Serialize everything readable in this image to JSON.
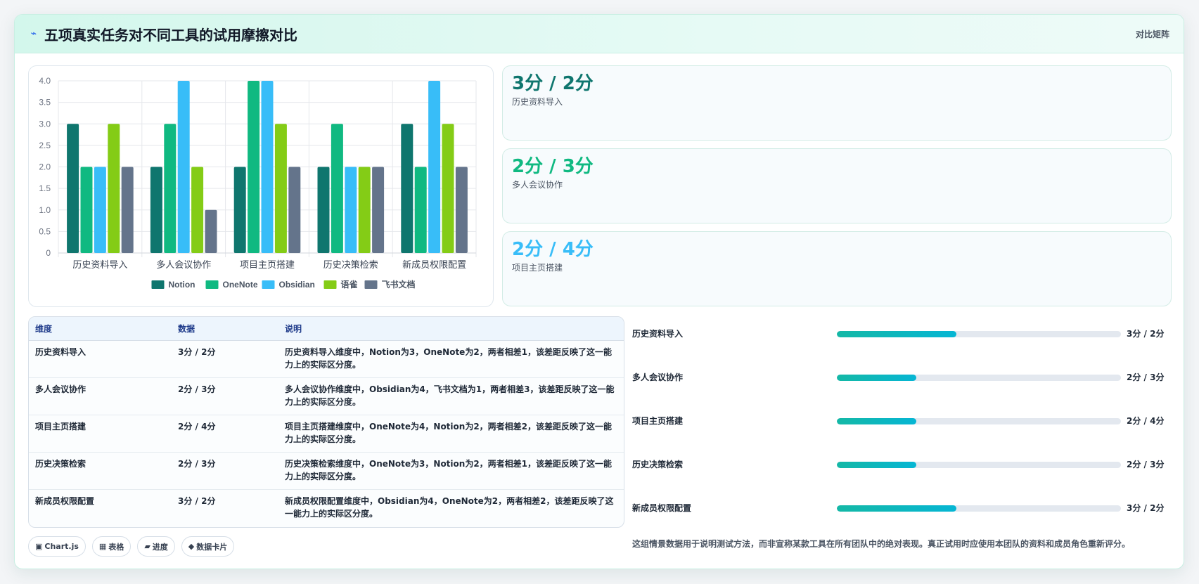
{
  "header": {
    "title": "五项真实任务对不同工具的试用摩擦对比",
    "tag": "对比矩阵",
    "icon": "bolt-icon"
  },
  "chart_data": {
    "type": "bar",
    "categories": [
      "历史资料导入",
      "多人会议协作",
      "项目主页搭建",
      "历史决策检索",
      "新成员权限配置"
    ],
    "series": [
      {
        "name": "Notion",
        "color": "#0f766e",
        "values": [
          3,
          2,
          2,
          2,
          3
        ]
      },
      {
        "name": "OneNote",
        "color": "#10b981",
        "values": [
          2,
          3,
          4,
          3,
          2
        ]
      },
      {
        "name": "Obsidian",
        "color": "#38bdf8",
        "values": [
          2,
          4,
          4,
          2,
          4
        ]
      },
      {
        "name": "语雀",
        "color": "#84cc16",
        "values": [
          3,
          2,
          3,
          2,
          3
        ]
      },
      {
        "name": "飞书文档",
        "color": "#64748b",
        "values": [
          2,
          1,
          2,
          2,
          2
        ]
      }
    ],
    "ylim": [
      0,
      4
    ],
    "yticks": [
      "0",
      "0.5",
      "1.0",
      "1.5",
      "2.0",
      "2.5",
      "3.0",
      "3.5",
      "4.0"
    ],
    "grid": true,
    "legend": "bottom"
  },
  "stats": [
    {
      "value": "3分 / 2分",
      "label": "历史资料导入",
      "color": "#0f766e"
    },
    {
      "value": "2分 / 3分",
      "label": "多人会议协作",
      "color": "#10b981"
    },
    {
      "value": "2分 / 4分",
      "label": "项目主页搭建",
      "color": "#38bdf8"
    }
  ],
  "table": {
    "headers": [
      "维度",
      "数据",
      "说明"
    ],
    "rows": [
      [
        "历史资料导入",
        "3分 / 2分",
        "历史资料导入维度中，Notion为3，OneNote为2，两者相差1，该差距反映了这一能力上的实际区分度。"
      ],
      [
        "多人会议协作",
        "2分 / 3分",
        "多人会议协作维度中，Obsidian为4，飞书文档为1，两者相差3，该差距反映了这一能力上的实际区分度。"
      ],
      [
        "项目主页搭建",
        "2分 / 4分",
        "项目主页搭建维度中，OneNote为4，Notion为2，两者相差2，该差距反映了这一能力上的实际区分度。"
      ],
      [
        "历史决策检索",
        "2分 / 3分",
        "历史决策检索维度中，OneNote为3，Notion为2，两者相差1，该差距反映了这一能力上的实际区分度。"
      ],
      [
        "新成员权限配置",
        "3分 / 2分",
        "新成员权限配置维度中，Obsidian为4，OneNote为2，两者相差2，该差距反映了这一能力上的实际区分度。"
      ]
    ]
  },
  "chips": [
    {
      "icon": "▣",
      "label": "Chart.js"
    },
    {
      "icon": "▦",
      "label": "表格"
    },
    {
      "icon": "▰",
      "label": "进度"
    },
    {
      "icon": "◆",
      "label": "数据卡片"
    }
  ],
  "progress": [
    {
      "label": "历史资料导入",
      "fraction": 0.42,
      "value": "3分 / 2分"
    },
    {
      "label": "多人会议协作",
      "fraction": 0.28,
      "value": "2分 / 3分"
    },
    {
      "label": "项目主页搭建",
      "fraction": 0.28,
      "value": "2分 / 4分"
    },
    {
      "label": "历史决策检索",
      "fraction": 0.28,
      "value": "2分 / 3分"
    },
    {
      "label": "新成员权限配置",
      "fraction": 0.42,
      "value": "3分 / 2分"
    }
  ],
  "note": "这组情景数据用于说明测试方法，而非宣称某款工具在所有团队中的绝对表现。真正试用时应使用本团队的资料和成员角色重新评分。"
}
